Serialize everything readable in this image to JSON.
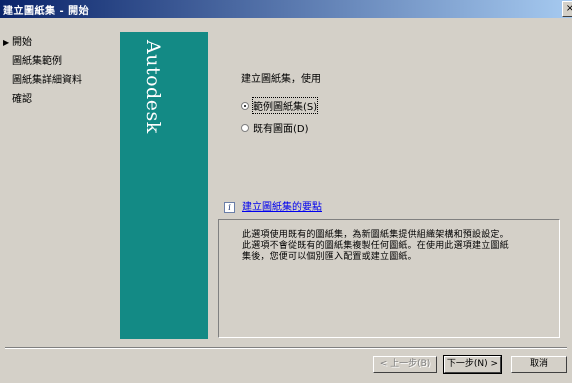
{
  "window": {
    "title": "建立圖紙集 - 開始",
    "close_label": "×"
  },
  "steps": [
    {
      "label": "開始",
      "current": true
    },
    {
      "label": "圖紙集範例",
      "current": false
    },
    {
      "label": "圖紙集詳細資料",
      "current": false
    },
    {
      "label": "確認",
      "current": false
    }
  ],
  "logo": {
    "text": "Autodesk"
  },
  "main": {
    "prompt": "建立圖紙集，使用",
    "options": [
      {
        "label": "範例圖紙集(S)",
        "checked": true
      },
      {
        "label": "既有圖面(D)",
        "checked": false
      }
    ],
    "help_link": "建立圖紙集的要點",
    "description": "此選項使用既有的圖紙集，為新圖紙集提供組織架構和預設設定。此選項不會從既有的圖紙集複製任何圖紙。在使用此選項建立圖紙集後，您便可以個別匯入配置或建立圖紙。"
  },
  "buttons": {
    "back": "< 上一步(B)",
    "next": "下一步(N) >",
    "cancel": "取消"
  }
}
